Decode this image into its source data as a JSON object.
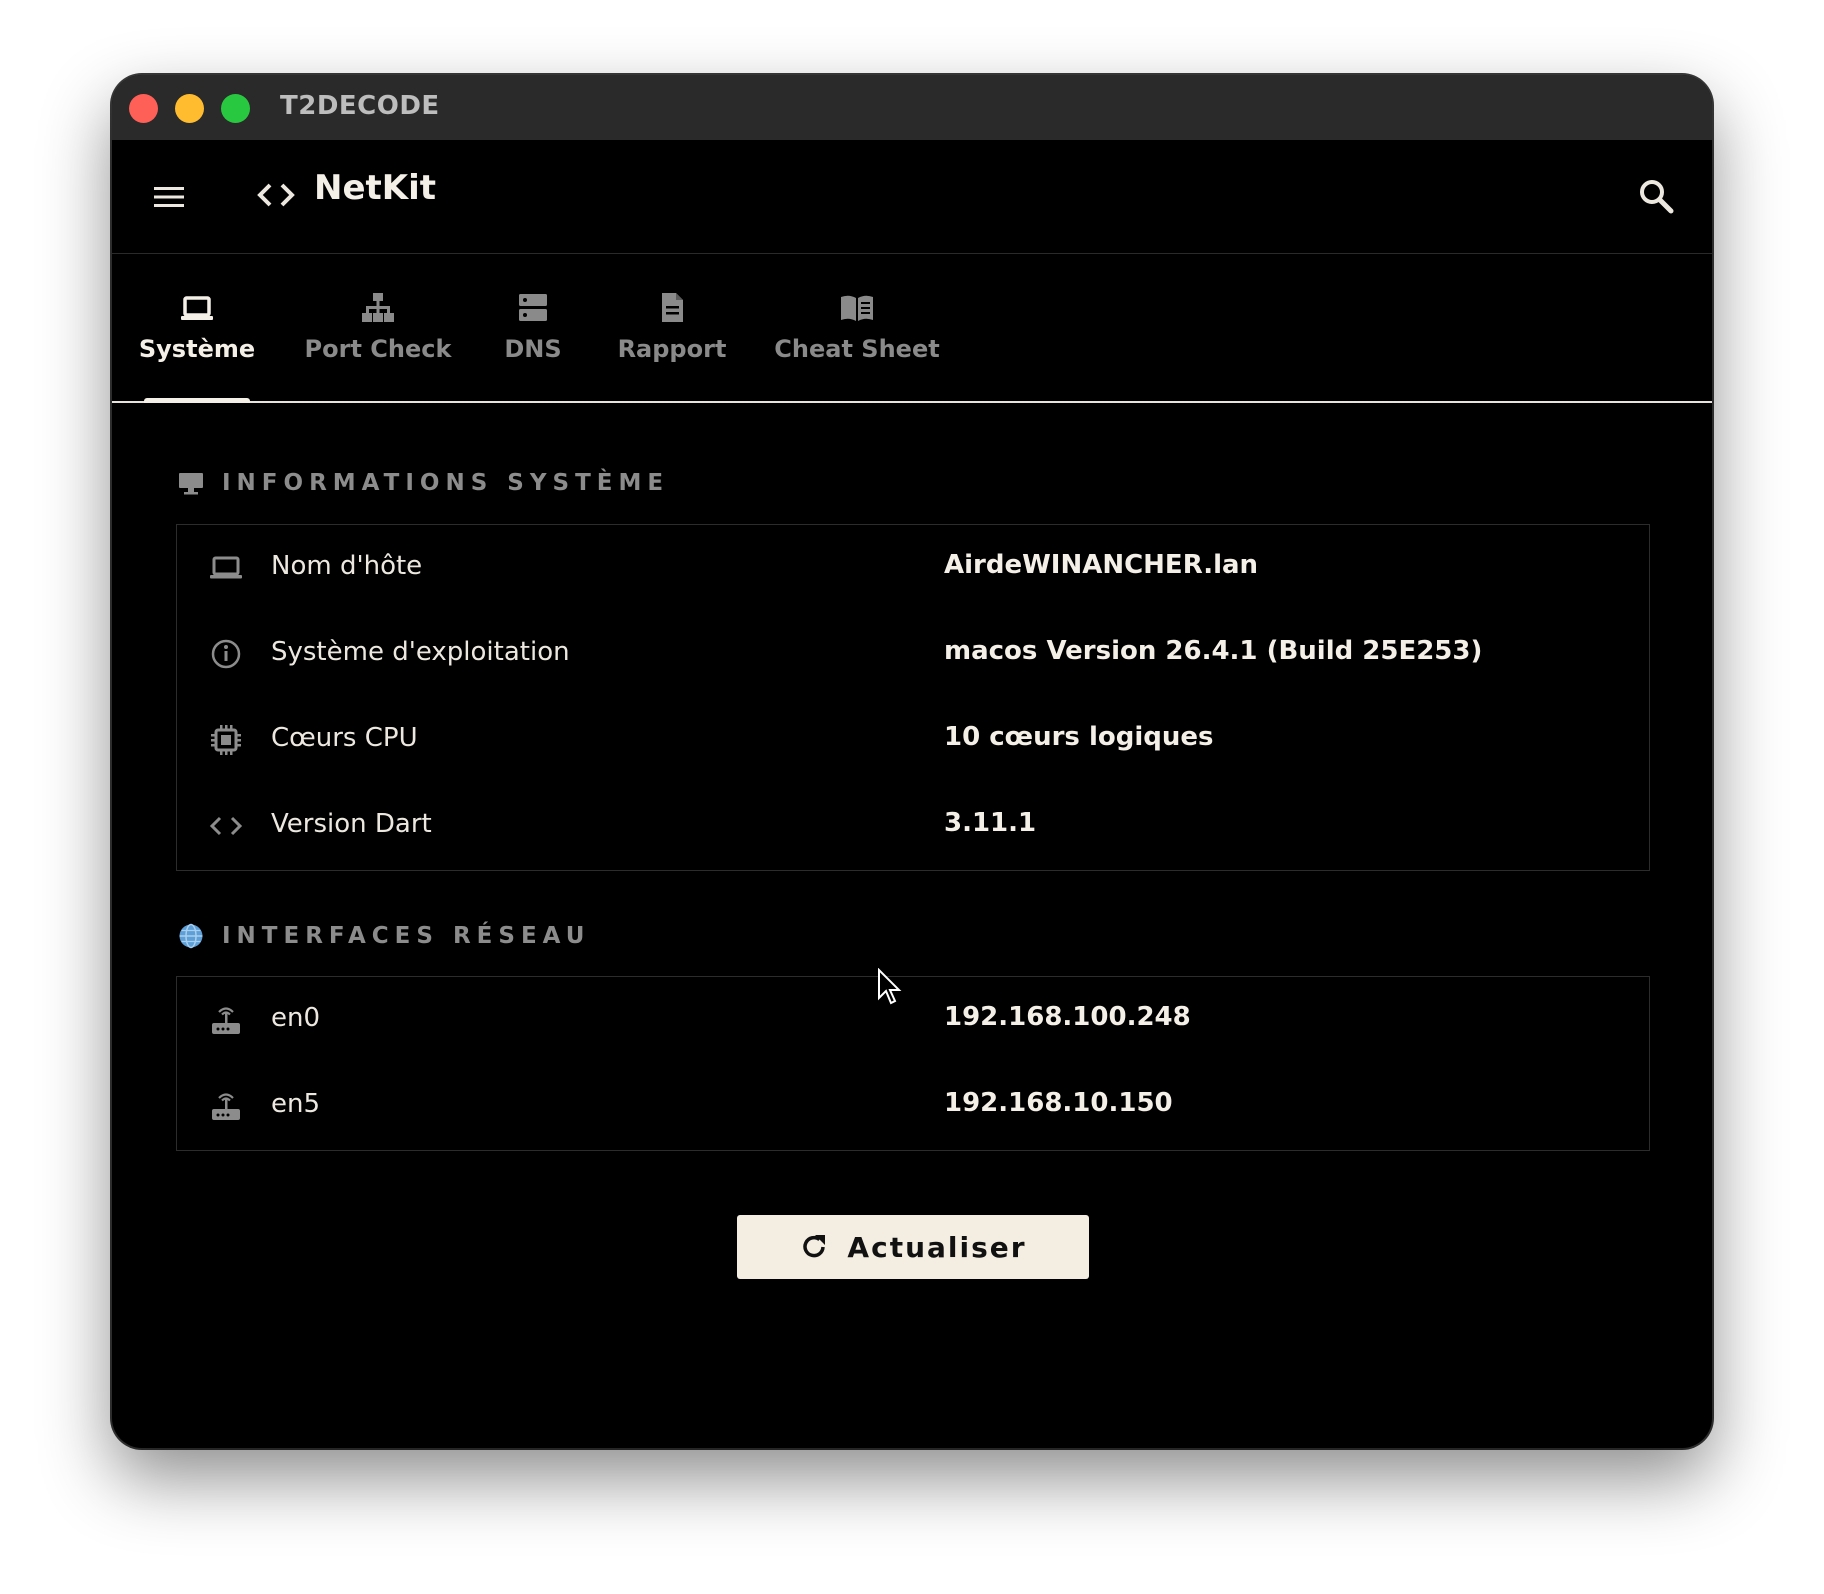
{
  "window": {
    "title": "T2DECODE"
  },
  "appbar": {
    "title": "NetKit",
    "menu_icon": "menu-icon",
    "brand_icon": "code-icon",
    "search_icon": "search-icon"
  },
  "tabs": [
    {
      "label": "Système",
      "icon": "laptop-icon",
      "active": true
    },
    {
      "label": "Port Check",
      "icon": "network-tree-icon",
      "active": false
    },
    {
      "label": "DNS",
      "icon": "server-icon",
      "active": false
    },
    {
      "label": "Rapport",
      "icon": "document-icon",
      "active": false
    },
    {
      "label": "Cheat Sheet",
      "icon": "book-icon",
      "active": false
    }
  ],
  "system_section": {
    "title": "INFORMATIONS SYSTÈME",
    "icon": "monitor-icon",
    "rows": [
      {
        "label": "Nom d'hôte",
        "value": "AirdeWINANCHER.lan",
        "icon": "laptop-icon"
      },
      {
        "label": "Système d'exploitation",
        "value": "macos Version 26.4.1 (Build 25E253)",
        "icon": "info-icon"
      },
      {
        "label": "Cœurs CPU",
        "value": "10 cœurs logiques",
        "icon": "chip-icon"
      },
      {
        "label": "Version Dart",
        "value": "3.11.1",
        "icon": "code-icon"
      }
    ]
  },
  "network_section": {
    "title": "INTERFACES RÉSEAU",
    "icon": "globe-icon",
    "rows": [
      {
        "label": "en0",
        "value": "192.168.100.248",
        "icon": "router-icon"
      },
      {
        "label": "en5",
        "value": "192.168.10.150",
        "icon": "router-icon"
      }
    ]
  },
  "refresh_button": {
    "label": "Actualiser",
    "icon": "refresh-icon"
  },
  "colors": {
    "background": "#000000",
    "titlebar": "#2b2a2a",
    "text_primary": "#f4f0e8",
    "text_muted": "#8c8c8c",
    "button_bg": "#f3ede2",
    "close": "#fe5f57",
    "minimize": "#febc2e",
    "zoom": "#28c840"
  }
}
